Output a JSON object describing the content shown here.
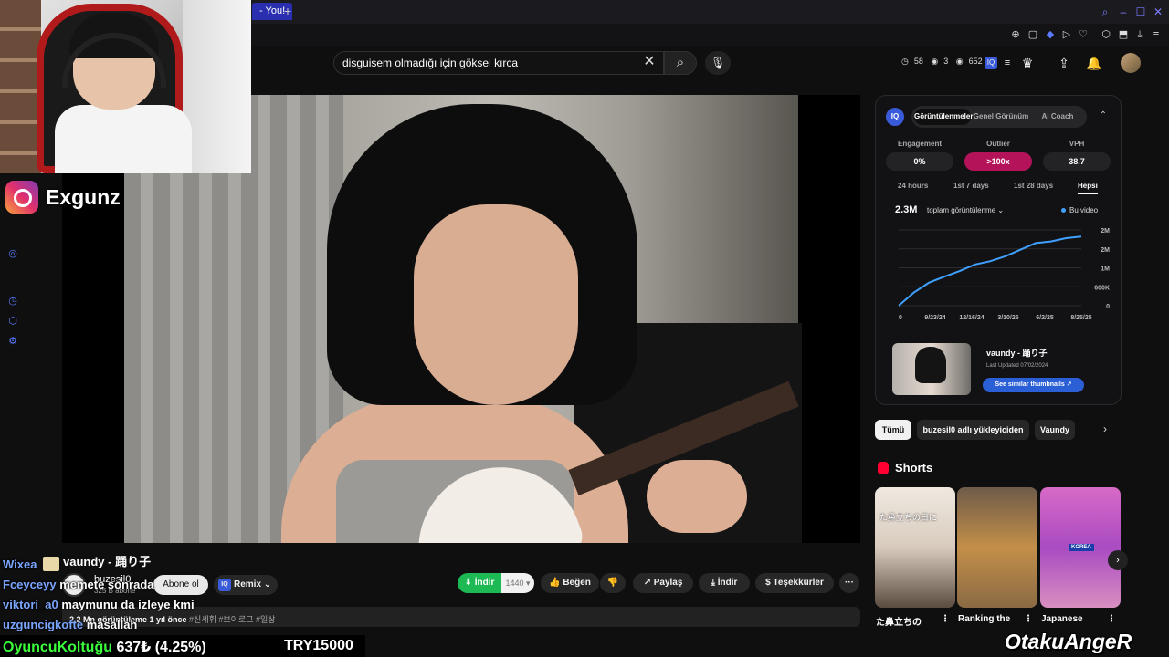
{
  "browser": {
    "tab_title": "- You!",
    "new_tab": "+",
    "win_controls": [
      "⌕",
      "–",
      "☐",
      "✕"
    ],
    "ext_icons": [
      "⊕",
      "▢",
      "◆",
      "▷",
      "♡",
      "⬡",
      "⬒",
      "⤓",
      "≡"
    ]
  },
  "streamer": {
    "instagram_handle": "Exgunz"
  },
  "search": {
    "query": "disguisem olmadığı için göksel kırca"
  },
  "header_stats": {
    "a": "58",
    "b": "3",
    "c": "652"
  },
  "video": {
    "title": "vaundy - 踊り子",
    "channel": "buzesil0",
    "subscribers": "325 B abone",
    "subscribe_label": "Abone ol",
    "remix_label": "Remix",
    "remix_badge": "IQ",
    "download_green": "İndir",
    "quality": "1440",
    "like_label": "Beğen",
    "share_label": "Paylaş",
    "download_label": "İndir",
    "thanks_label": "Teşekkürler",
    "more_label": "···",
    "views_line": "2.2 Mn görüntüleme  1 yıl önce",
    "hashtags": " #신세휘 #브이로그 #일상"
  },
  "chat": [
    {
      "user": "Wixea",
      "text": ""
    },
    {
      "user": "Fceyceyy",
      "text": "memete sonrada"
    },
    {
      "user": "viktori_a0",
      "text": "maymunu da izleye kmi"
    },
    {
      "user": "uzguncigkofte",
      "text": "masallah"
    }
  ],
  "ticker": {
    "label": "OyuncuKoltuğu",
    "value": "637₺ (4.25%)",
    "price": "TRY15000"
  },
  "watermark": "OtakuAngeR",
  "iq_panel": {
    "logo": "IQ",
    "tabs": [
      "Görüntülenmeler",
      "Genel Görünüm",
      "AI Coach"
    ],
    "metrics": [
      {
        "label": "Engagement",
        "value": "0%"
      },
      {
        "label": "Outlier",
        "value": ">100x"
      },
      {
        "label": "VPH",
        "value": "38.7"
      }
    ],
    "ranges": [
      "24 hours",
      "1st 7 days",
      "1st 28 days",
      "Hepsi"
    ],
    "total_views": "2.3M",
    "total_label": "toplam görüntülenme",
    "legend": "Bu video",
    "song_title": "vaundy - 踊り子",
    "last_updated": "Last Updated 07/02/2024",
    "similar_label": "See similar thumbnails ↗"
  },
  "chart_data": {
    "type": "line",
    "x_ticks": [
      "0",
      "9/23/24",
      "12/16/24",
      "3/10/25",
      "6/2/25",
      "8/25/25"
    ],
    "y_ticks": [
      "2M",
      "2M",
      "1M",
      "600K",
      "0"
    ],
    "series": [
      {
        "name": "Bu video",
        "values": [
          0,
          400000,
          700000,
          880000,
          1050000,
          1250000,
          1350000,
          1500000,
          1700000,
          1900000,
          1950000,
          2050000,
          2100000
        ]
      }
    ],
    "ylim": [
      0,
      2300000
    ],
    "color": "#3fa0ff"
  },
  "chips": [
    "Tümü",
    "buzesil0 adlı yükleyiciden",
    "Vaundy"
  ],
  "shorts": {
    "title": "Shorts",
    "items": [
      {
        "caption": "た鼻立ちの日に",
        "title": "た鼻立ちの"
      },
      {
        "caption": "",
        "title": "Ranking the"
      },
      {
        "caption": "KOREA",
        "title": "Japanese"
      }
    ]
  }
}
